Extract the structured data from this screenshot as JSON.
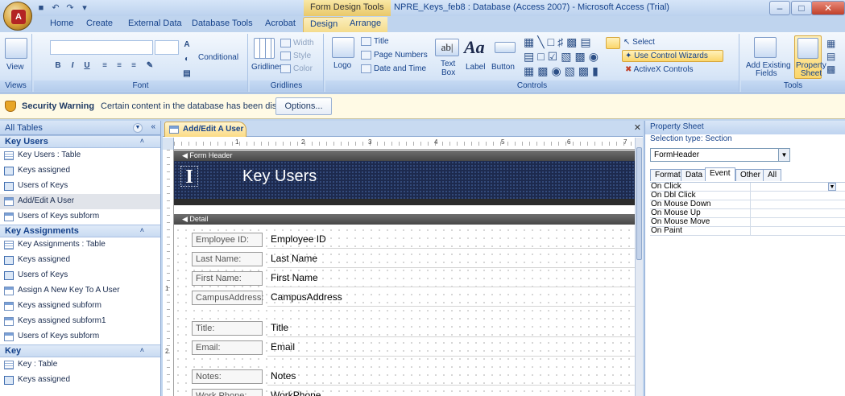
{
  "titlebar": {
    "tools_label": "Form Design Tools",
    "window_title": "NPRE_Keys_feb8 : Database (Access 2007) - Microsoft Access (Trial)"
  },
  "tabs": [
    {
      "label": "Home"
    },
    {
      "label": "Create"
    },
    {
      "label": "External Data"
    },
    {
      "label": "Database Tools"
    },
    {
      "label": "Acrobat"
    },
    {
      "label": "Design"
    },
    {
      "label": "Arrange"
    }
  ],
  "ribbon": {
    "views": {
      "view_label": "View",
      "group_label": "Views"
    },
    "font": {
      "conditional_label": "Conditional",
      "group_label": "Font"
    },
    "gridlines": {
      "gridlines_label": "Gridlines",
      "width_label": "Width",
      "style_label": "Style",
      "color_label": "Color",
      "group_label": "Gridlines"
    },
    "controls": {
      "logo_label": "Logo",
      "title_label": "Title",
      "page_numbers_label": "Page Numbers",
      "date_time_label": "Date and Time",
      "textbox_label_1": "Text",
      "textbox_label_2": "Box",
      "label_label": "Label",
      "button_label": "Button",
      "select_label": "Select",
      "wizards_label": "Use Control Wizards",
      "activex_label": "ActiveX Controls",
      "group_label": "Controls"
    },
    "tools": {
      "add_fields_1": "Add Existing",
      "add_fields_2": "Fields",
      "property_1": "Property",
      "property_2": "Sheet",
      "group_label": "Tools"
    }
  },
  "security": {
    "label": "Security Warning",
    "message": "Certain content in the database has been disabled",
    "options_label": "Options..."
  },
  "nav": {
    "header": "All Tables",
    "groups": [
      {
        "title": "Key Users",
        "items": [
          "Key Users : Table",
          "Keys assigned",
          "Users of Keys",
          "Add/Edit A User",
          "Users of Keys subform"
        ]
      },
      {
        "title": "Key Assignments",
        "items": [
          "Key Assignments : Table",
          "Keys assigned",
          "Users of Keys",
          "Assign A New Key To A User",
          "Keys assigned subform",
          "Keys assigned subform1",
          "Users of Keys subform"
        ]
      },
      {
        "title": "Key",
        "items": [
          "Key : Table",
          "Keys assigned"
        ]
      }
    ]
  },
  "doc": {
    "tab_label": "Add/Edit A User",
    "ruler_numbers": [
      "1",
      "2",
      "3",
      "4",
      "5",
      "6",
      "7"
    ],
    "vruler_numbers": [
      "1",
      "2"
    ],
    "form_header_label": "Form Header",
    "header_title": "Key Users",
    "detail_label": "Detail",
    "fields": [
      {
        "label": "Employee ID:",
        "value": "Employee ID"
      },
      {
        "label": "Last Name:",
        "value": "Last Name"
      },
      {
        "label": "First Name:",
        "value": "First Name"
      },
      {
        "label": "CampusAddress:",
        "value": "CampusAddress"
      },
      {
        "label": "Title:",
        "value": "Title"
      },
      {
        "label": "Email:",
        "value": "Email"
      },
      {
        "label": "Notes:",
        "value": "Notes"
      },
      {
        "label": "Work Phone:",
        "value": "WorkPhone"
      }
    ]
  },
  "property_sheet": {
    "title": "Property Sheet",
    "selection_type": "Selection type:  Section",
    "selected_object": "FormHeader",
    "tabs": [
      "Format",
      "Data",
      "Event",
      "Other",
      "All"
    ],
    "active_tab": "Event",
    "rows": [
      "On Click",
      "On Dbl Click",
      "On Mouse Down",
      "On Mouse Up",
      "On Mouse Move",
      "On Paint"
    ]
  }
}
